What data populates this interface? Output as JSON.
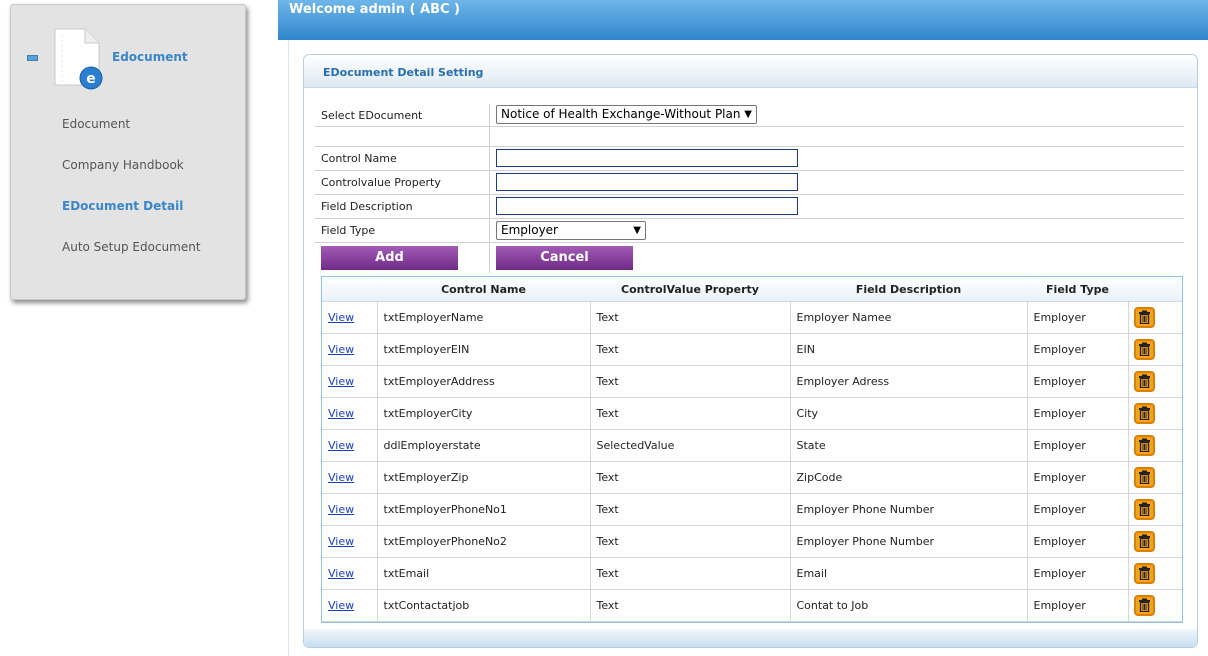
{
  "header": {
    "welcome": "Welcome admin ( ABC )"
  },
  "sidebar": {
    "title": "Edocument",
    "icon": "edocument-icon",
    "items": [
      {
        "label": "Edocument",
        "active": false
      },
      {
        "label": "Company Handbook",
        "active": false
      },
      {
        "label": "EDocument Detail",
        "active": true
      },
      {
        "label": "Auto Setup Edocument",
        "active": false
      }
    ]
  },
  "panel": {
    "title": "EDocument Detail Setting"
  },
  "form": {
    "select_edocument_label": "Select EDocument",
    "select_edocument_value": "Notice of Health Exchange-Without Plan",
    "control_name_label": "Control Name",
    "control_name_value": "",
    "controlvalue_property_label": "Controlvalue Property",
    "controlvalue_property_value": "",
    "field_description_label": "Field Description",
    "field_description_value": "",
    "field_type_label": "Field Type",
    "field_type_value": "Employer",
    "add_label": "Add",
    "cancel_label": "Cancel"
  },
  "grid": {
    "columns": [
      "",
      "Control Name",
      "ControlValue Property",
      "Field Description",
      "Field Type",
      ""
    ],
    "view_label": "View",
    "rows": [
      {
        "control_name": "txtEmployerName",
        "property": "Text",
        "description": "Employer Namee",
        "type": "Employer"
      },
      {
        "control_name": "txtEmployerEIN",
        "property": "Text",
        "description": "EIN",
        "type": "Employer"
      },
      {
        "control_name": "txtEmployerAddress",
        "property": "Text",
        "description": "Employer Adress",
        "type": "Employer"
      },
      {
        "control_name": "txtEmployerCity",
        "property": "Text",
        "description": "City",
        "type": "Employer"
      },
      {
        "control_name": "ddlEmployerstate",
        "property": "SelectedValue",
        "description": "State",
        "type": "Employer"
      },
      {
        "control_name": "txtEmployerZip",
        "property": "Text",
        "description": "ZipCode",
        "type": "Employer"
      },
      {
        "control_name": "txtEmployerPhoneNo1",
        "property": "Text",
        "description": "Employer Phone Number",
        "type": "Employer"
      },
      {
        "control_name": "txtEmployerPhoneNo2",
        "property": "Text",
        "description": "Employer Phone Number",
        "type": "Employer"
      },
      {
        "control_name": "txtEmail",
        "property": "Text",
        "description": "Email",
        "type": "Employer"
      },
      {
        "control_name": "txtContactatjob",
        "property": "Text",
        "description": "Contat to Job",
        "type": "Employer"
      }
    ]
  },
  "colors": {
    "header_top": "#6fb6e8",
    "header_bottom": "#2f86cc",
    "accent_blue": "#3a86c8",
    "button_purple": "#8a43a0",
    "delete_orange": "#f4a21a",
    "link_blue": "#1a3cc8"
  }
}
